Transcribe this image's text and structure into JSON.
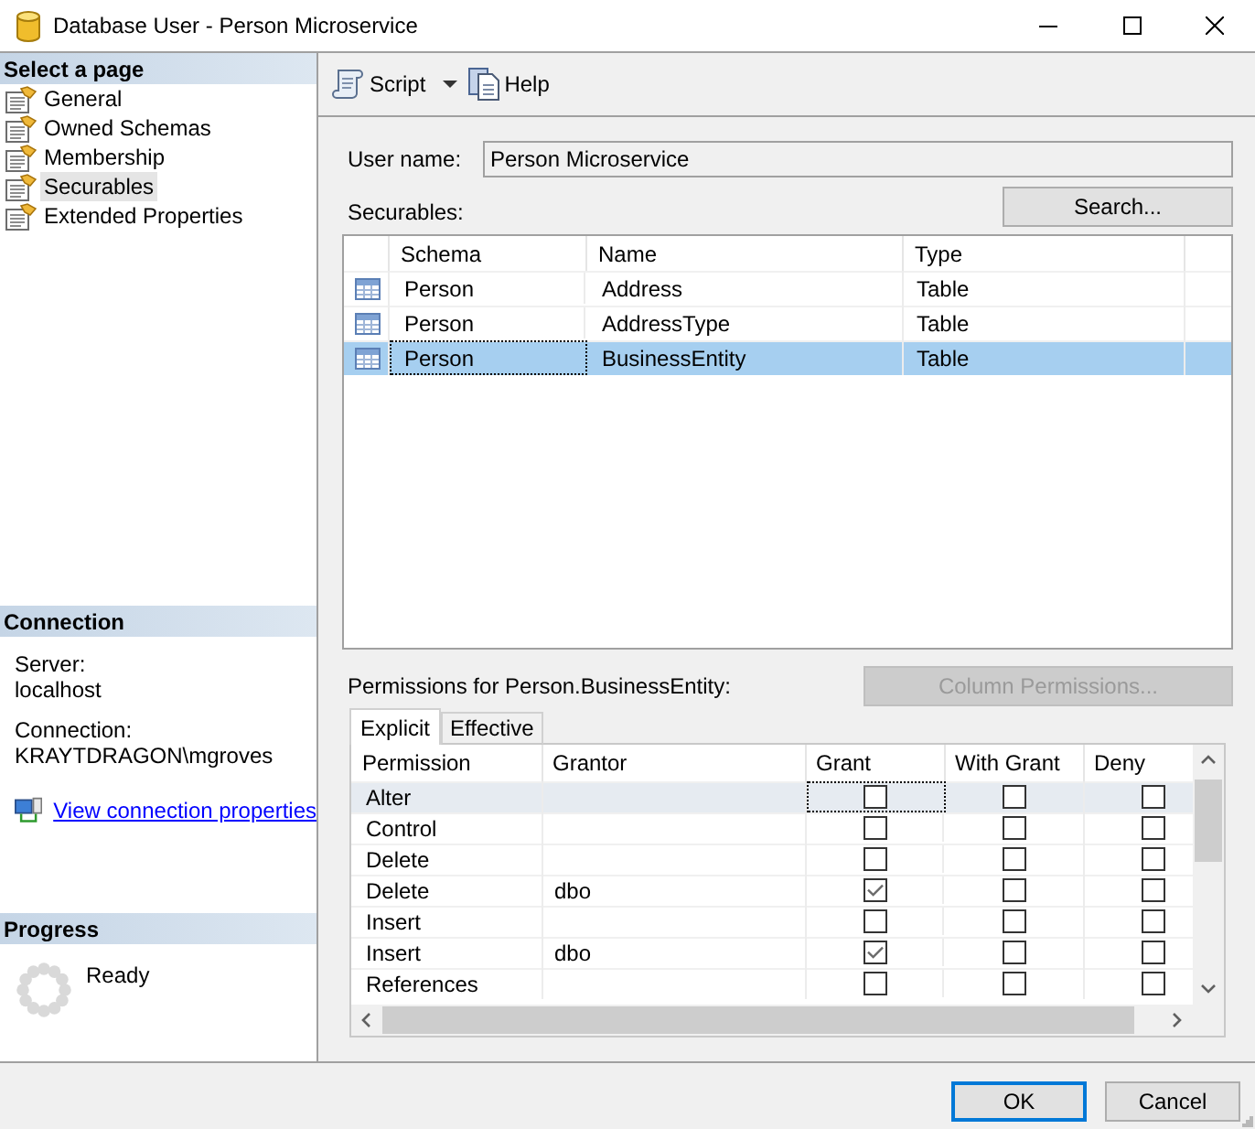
{
  "window": {
    "title": "Database User - Person Microservice"
  },
  "sidebar": {
    "pages": {
      "heading": "Select a page",
      "items": [
        {
          "label": "General",
          "selected": false
        },
        {
          "label": "Owned Schemas",
          "selected": false
        },
        {
          "label": "Membership",
          "selected": false
        },
        {
          "label": "Securables",
          "selected": true
        },
        {
          "label": "Extended Properties",
          "selected": false
        }
      ]
    },
    "connection": {
      "heading": "Connection",
      "fields": [
        {
          "label": "Server:",
          "value": "localhost"
        },
        {
          "label": "Connection:",
          "value": "KRAYTDRAGON\\mgroves"
        }
      ],
      "link": "View connection properties"
    },
    "progress": {
      "heading": "Progress",
      "status": "Ready"
    }
  },
  "toolbar": [
    {
      "label": "Script",
      "kind": "script"
    },
    {
      "label": "Help",
      "kind": "help"
    }
  ],
  "user_name": {
    "label": "User name:",
    "value": "Person Microservice"
  },
  "securables": {
    "label": "Securables:",
    "search_button": {
      "label": "Search...",
      "disabled": false
    },
    "columns": [
      "Schema",
      "Name",
      "Type"
    ],
    "rows": [
      {
        "schema": "Person",
        "name": "Address",
        "type": "Table",
        "selected": false,
        "focused": false
      },
      {
        "schema": "Person",
        "name": "AddressType",
        "type": "Table",
        "selected": false,
        "focused": false
      },
      {
        "schema": "Person",
        "name": "BusinessEntity",
        "type": "Table",
        "selected": true,
        "focused": true
      }
    ]
  },
  "permissions": {
    "label": "Permissions for Person.BusinessEntity:",
    "column_permissions_button": {
      "label": "Column Permissions...",
      "disabled": true
    },
    "tabs": [
      {
        "label": "Explicit",
        "selected": true
      },
      {
        "label": "Effective",
        "selected": false
      }
    ],
    "columns": [
      "Permission",
      "Grantor",
      "Grant",
      "With Grant",
      "Deny"
    ],
    "rows": [
      {
        "permission": "Alter",
        "grant": false,
        "with_grant": false,
        "deny": false,
        "selected": true,
        "focused": true
      },
      {
        "permission": "Control",
        "grant": false,
        "with_grant": false,
        "deny": false,
        "selected": false,
        "focused": false
      },
      {
        "permission": "Delete",
        "grant": false,
        "with_grant": false,
        "deny": false,
        "selected": false,
        "focused": false
      },
      {
        "permission": "Delete",
        "grantor": "dbo",
        "grant": true,
        "with_grant": false,
        "deny": false,
        "selected": false,
        "focused": false
      },
      {
        "permission": "Insert",
        "grant": false,
        "with_grant": false,
        "deny": false,
        "selected": false,
        "focused": false
      },
      {
        "permission": "Insert",
        "grantor": "dbo",
        "grant": true,
        "with_grant": false,
        "deny": false,
        "selected": false,
        "focused": false
      },
      {
        "permission": "References",
        "grant": false,
        "with_grant": false,
        "deny": false,
        "selected": false,
        "focused": false
      }
    ]
  },
  "buttons": [
    {
      "label": "OK",
      "default": true
    },
    {
      "label": "Cancel",
      "default": false
    }
  ]
}
